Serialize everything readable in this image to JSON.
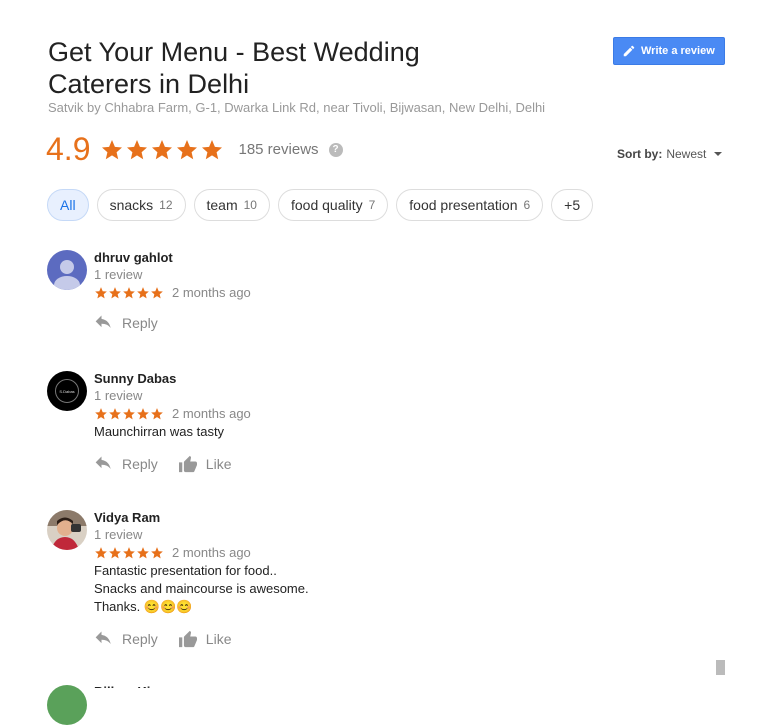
{
  "business": {
    "title": "Get Your Menu - Best Wedding Caterers in Delhi",
    "address": "Satvik by Chhabra Farm, G-1, Dwarka Link Rd, near Tivoli, Bijwasan, New Delhi, Delhi"
  },
  "write_review_label": "Write a review",
  "summary": {
    "rating": "4.9",
    "stars": 5,
    "reviews_label": "185 reviews",
    "help_glyph": "?"
  },
  "sort": {
    "label": "Sort by:",
    "value": "Newest"
  },
  "chips": [
    {
      "label": "All",
      "count": ""
    },
    {
      "label": "snacks",
      "count": "12"
    },
    {
      "label": "team",
      "count": "10"
    },
    {
      "label": "food quality",
      "count": "7"
    },
    {
      "label": "food presentation",
      "count": "6"
    },
    {
      "label": "+5",
      "count": ""
    }
  ],
  "reviews": [
    {
      "name": "dhruv gahlot",
      "meta": "1 review",
      "time": "2 months ago",
      "text": [],
      "reply_label": "Reply",
      "like_label": ""
    },
    {
      "name": "Sunny Dabas",
      "meta": "1 review",
      "time": "2 months ago",
      "avatar_text": "S.Dabas",
      "text": [
        "Maunchirran was tasty"
      ],
      "reply_label": "Reply",
      "like_label": "Like"
    },
    {
      "name": "Vidya Ram",
      "meta": "1 review",
      "time": "2 months ago",
      "text": [
        "Fantastic presentation for food..",
        "Snacks and maincourse is awesome.",
        "Thanks. 😊😊😊"
      ],
      "reply_label": "Reply",
      "like_label": "Like"
    }
  ],
  "next_review_name": "Bilhan Ki",
  "colors": {
    "star": "#e7711b",
    "accent": "#4a8af4",
    "chip_active_bg": "#e8f0fe"
  }
}
